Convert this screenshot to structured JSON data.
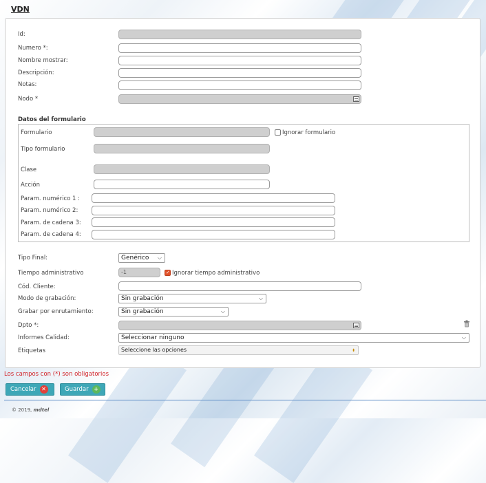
{
  "page": {
    "title": "VDN"
  },
  "form": {
    "id_label": "Id:",
    "numero_label": "Numero *:",
    "nombre_label": "Nombre mostrar:",
    "descripcion_label": "Descripción:",
    "notas_label": "Notas:",
    "nodo_label": "Nodo *",
    "datos_section": "Datos del formulario",
    "formulario_label": "Formulario",
    "ignorar_formulario_label": "Ignorar formulario",
    "ignorar_formulario_checked": false,
    "tipo_formulario_label": "Tipo formulario",
    "clase_label": "Clase",
    "accion_label": "Acción",
    "param_num1_label": "Param. numérico 1 :",
    "param_num2_label": "Param. numérico 2:",
    "param_cad3_label": "Param. de cadena 3:",
    "param_cad4_label": "Param. de cadena 4:",
    "tipo_final_label": "Tipo Final:",
    "tipo_final_value": "Genérico",
    "tiempo_admin_label": "Tiempo administrativo",
    "tiempo_admin_value": "-1",
    "ignorar_tiempo_label": "Ignorar tiempo administrativo",
    "ignorar_tiempo_checked": true,
    "cod_cliente_label": "Cód. Cliente:",
    "modo_grabacion_label": "Modo de grabación:",
    "modo_grabacion_value": "Sin grabación",
    "grabar_enrut_label": "Grabar por enrutamiento:",
    "grabar_enrut_value": "Sin grabación",
    "dpto_label": "Dpto *:",
    "informes_label": "Informes Calidad:",
    "informes_value": "Seleccionar ninguno",
    "etiquetas_label": "Etiquetas",
    "etiquetas_placeholder": "Seleccione las opciones"
  },
  "required_note": "Los campos con (*) son obligatorios",
  "buttons": {
    "cancel_label": "Cancelar",
    "save_label": "Guardar"
  },
  "footer": {
    "copyright": "© 2019,",
    "brand": "mdtel"
  },
  "icons": {
    "cancel": "x-circle-icon",
    "save": "plus-circle-icon",
    "picker": "list-picker-icon",
    "trash": "trash-icon"
  },
  "colors": {
    "button": "#3ea7b7",
    "required_text": "#d2242a",
    "checkbox_checked": "#e0522a",
    "footer_line": "#5b8bc5"
  }
}
